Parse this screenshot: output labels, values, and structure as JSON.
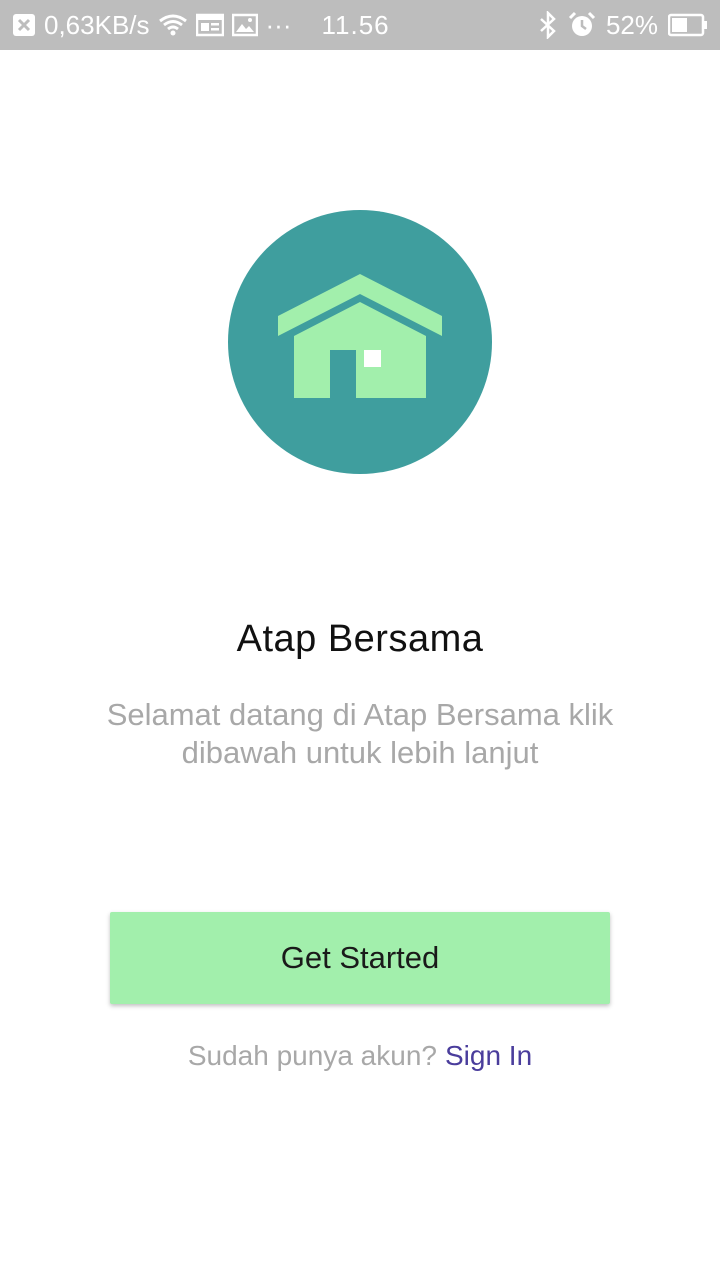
{
  "status_bar": {
    "network_speed": "0,63KB/s",
    "more": "···",
    "time": "11.56",
    "battery_percent": "52%",
    "battery_level": 0.52,
    "icons": [
      "close-notification-icon",
      "wifi-icon",
      "calendar-icon",
      "image-icon",
      "bluetooth-icon",
      "alarm-icon",
      "battery-icon"
    ]
  },
  "logo": {
    "icon": "house-icon",
    "circle_color": "#3f9e9e",
    "house_color": "#a2efac"
  },
  "welcome": {
    "title": "Atap Bersama",
    "subtitle_line1": "Selamat datang di Atap Bersama klik",
    "subtitle_line2": "dibawah untuk lebih lanjut"
  },
  "actions": {
    "get_started_label": "Get Started",
    "signin_prompt": "Sudah punya akun?",
    "signin_link": "Sign In",
    "accent_color": "#4a3d9c",
    "button_color": "#a2efac"
  }
}
